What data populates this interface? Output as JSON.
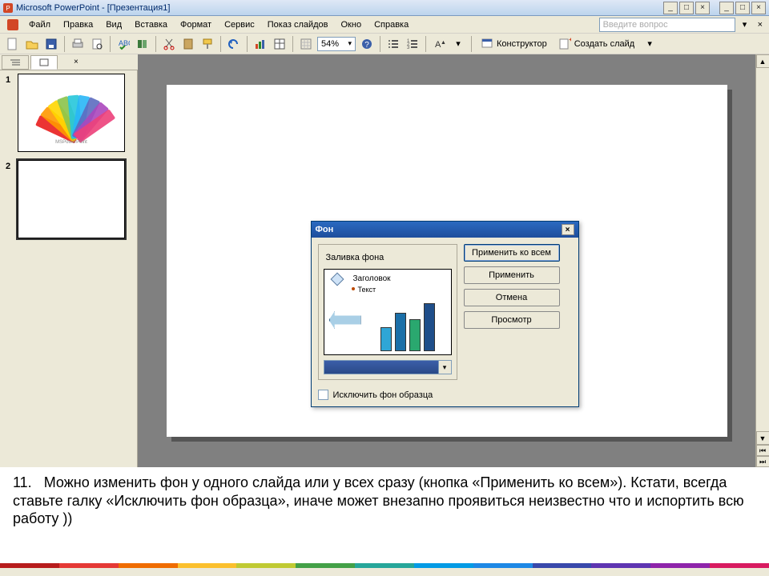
{
  "titlebar": {
    "text": "Microsoft PowerPoint - [Презентация1]"
  },
  "menus": {
    "file": "Файл",
    "edit": "Правка",
    "view": "Вид",
    "insert": "Вставка",
    "format": "Формат",
    "tools": "Сервис",
    "slideshow": "Показ слайдов",
    "window": "Окно",
    "help": "Справка"
  },
  "helpbox": {
    "placeholder": "Введите вопрос"
  },
  "toolbar": {
    "zoom": "54%",
    "designer": "Конструктор",
    "new_slide": "Создать слайд"
  },
  "thumbnails": {
    "slides": [
      {
        "num": "1"
      },
      {
        "num": "2"
      }
    ]
  },
  "dialog": {
    "title": "Фон",
    "fieldset_legend": "Заливка фона",
    "preview_title": "Заголовок",
    "preview_bullet": "Текст",
    "btn_apply_all": "Применить ко всем",
    "btn_apply": "Применить",
    "btn_cancel": "Отмена",
    "btn_preview": "Просмотр",
    "chk_exclude": "Исключить фон образца"
  },
  "caption": {
    "num": "11.",
    "body": "Можно изменить фон у одного слайда или у всех сразу (кнопка «Применить ко всем»). Кстати, всегда ставьте галку «Исключить фон образца», иначе может внезапно проявиться неизвестно что и испортить всю работу ))"
  },
  "footer_colors": [
    "#b71c1c",
    "#e53935",
    "#ef6c00",
    "#fbc02d",
    "#c0ca33",
    "#43a047",
    "#26a69a",
    "#039be5",
    "#1e88e5",
    "#3949ab",
    "#5e35b1",
    "#8e24aa",
    "#d81b60"
  ]
}
